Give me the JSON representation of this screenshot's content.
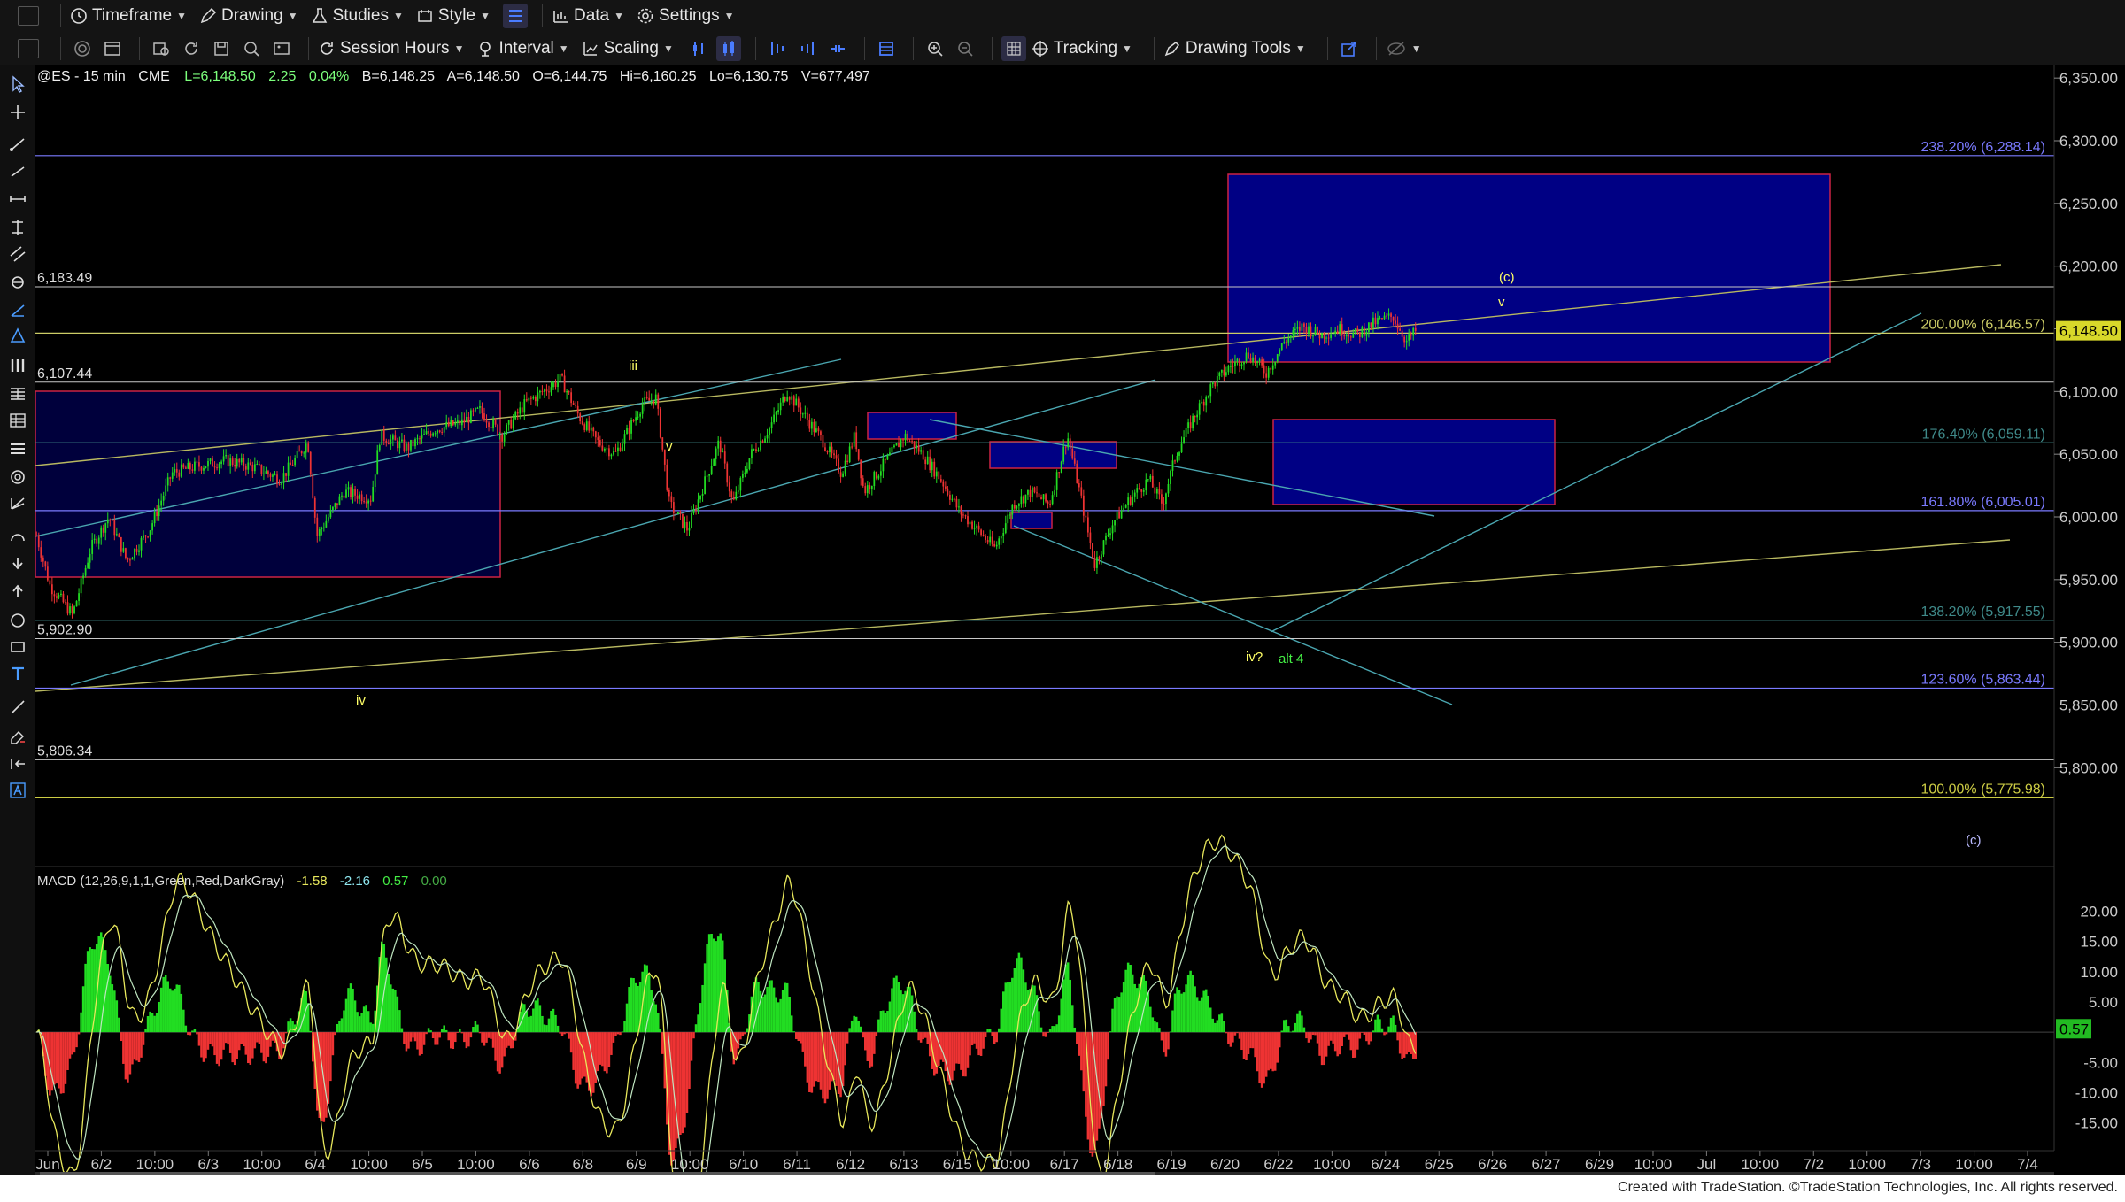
{
  "toolbar1": {
    "items": [
      "Timeframe",
      "Drawing",
      "Studies",
      "Style",
      "Data",
      "Settings"
    ]
  },
  "toolbar2": {
    "items": [
      "Session Hours",
      "Interval",
      "Scaling",
      "Tracking",
      "Drawing Tools"
    ]
  },
  "symbol_info": {
    "symbol": "@ES - 15 min",
    "exchange": "CME",
    "last": "L=6,148.50",
    "change": "2.25",
    "change_pct": "0.04%",
    "bid": "B=6,148.25",
    "ask": "A=6,148.50",
    "open": "O=6,144.75",
    "hi": "Hi=6,160.25",
    "lo": "Lo=6,130.75",
    "volume": "V=677,497"
  },
  "macd_label": {
    "name": "MACD (12,26,9,1,1,Green,Red,DarkGray)",
    "v1": "-1.58",
    "v2": "-2.16",
    "v3": "0.57",
    "v4": "0.00"
  },
  "colors": {
    "up": "#22dd22",
    "down": "#ee3333",
    "fib": "#7a7aff",
    "box": "#00008b",
    "trend_yellow": "#cccc66",
    "trend_cyan": "#5fb3b3",
    "label_yellow": "#ffff66",
    "label_green": "#44ee44",
    "price_tag": "#d8d82a"
  },
  "chart_data": {
    "type": "candlestick",
    "y_axis": {
      "min": 5760,
      "max": 6360,
      "ticks": [
        "6,350.00",
        "6,300.00",
        "6,250.00",
        "6,200.00",
        "6,150.00",
        "6,100.00",
        "6,050.00",
        "6,000.00",
        "5,950.00",
        "5,900.00",
        "5,850.00",
        "5,800.00"
      ],
      "current_price": "6,148.50"
    },
    "x_ticks": [
      "Jun",
      "6/2",
      "10:00",
      "6/3",
      "10:00",
      "6/4",
      "10:00",
      "6/5",
      "10:00",
      "6/6",
      "6/8",
      "6/9",
      "10:00",
      "6/10",
      "6/11",
      "6/12",
      "6/13",
      "6/15",
      "10:00",
      "6/17",
      "6/18",
      "6/19",
      "6/20",
      "6/22",
      "10:00",
      "6/24",
      "6/25",
      "6/26",
      "6/27",
      "6/29",
      "10:00",
      "Jul",
      "10:00",
      "7/2",
      "10:00",
      "7/3",
      "10:00",
      "7/4"
    ],
    "fib_levels": [
      {
        "label": "238.20% (6,288.14)",
        "value": 6288.14
      },
      {
        "label": "200.00% (6,146.57)",
        "value": 6146.57
      },
      {
        "label": "176.40% (6,059.11)",
        "value": 6059.11
      },
      {
        "label": "161.80% (6,005.01)",
        "value": 6005.01
      },
      {
        "label": "138.20% (5,917.55)",
        "value": 5917.55
      },
      {
        "label": "123.60% (5,863.44)",
        "value": 5863.44
      },
      {
        "label": "100.00% (5,775.98)",
        "value": 5775.98
      }
    ],
    "horizontal_levels": [
      {
        "label": "6,183.49",
        "value": 6183.49
      },
      {
        "label": "6,107.44",
        "value": 6107.44
      },
      {
        "label": "5,902.90",
        "value": 5902.9
      },
      {
        "label": "5,806.34",
        "value": 5806.34
      }
    ],
    "wave_labels": [
      "iii",
      "iv",
      "v",
      "(c)",
      "v",
      "iv?",
      "alt 4",
      "(c)"
    ],
    "price_path": [
      {
        "x": 0,
        "y": 5985
      },
      {
        "x": 0.3,
        "y": 5945
      },
      {
        "x": 0.8,
        "y": 5922
      },
      {
        "x": 1.2,
        "y": 5975
      },
      {
        "x": 1.6,
        "y": 6000
      },
      {
        "x": 2.0,
        "y": 5965
      },
      {
        "x": 2.5,
        "y": 5990
      },
      {
        "x": 3.0,
        "y": 6035
      },
      {
        "x": 3.5,
        "y": 6040
      },
      {
        "x": 4.2,
        "y": 6045
      },
      {
        "x": 4.8,
        "y": 6040
      },
      {
        "x": 5.4,
        "y": 6030
      },
      {
        "x": 6.0,
        "y": 6060
      },
      {
        "x": 6.2,
        "y": 5985
      },
      {
        "x": 6.8,
        "y": 6020
      },
      {
        "x": 7.4,
        "y": 6015
      },
      {
        "x": 7.6,
        "y": 6065
      },
      {
        "x": 8.2,
        "y": 6055
      },
      {
        "x": 8.8,
        "y": 6070
      },
      {
        "x": 9.4,
        "y": 6075
      },
      {
        "x": 9.8,
        "y": 6085
      },
      {
        "x": 10.3,
        "y": 6065
      },
      {
        "x": 10.8,
        "y": 6090
      },
      {
        "x": 11.6,
        "y": 6110
      },
      {
        "x": 12.0,
        "y": 6080
      },
      {
        "x": 12.4,
        "y": 6060
      },
      {
        "x": 12.8,
        "y": 6050
      },
      {
        "x": 13.4,
        "y": 6090
      },
      {
        "x": 13.7,
        "y": 6095
      },
      {
        "x": 14.0,
        "y": 6010
      },
      {
        "x": 14.4,
        "y": 5990
      },
      {
        "x": 14.8,
        "y": 6030
      },
      {
        "x": 15.1,
        "y": 6060
      },
      {
        "x": 15.4,
        "y": 6010
      },
      {
        "x": 15.8,
        "y": 6050
      },
      {
        "x": 16.2,
        "y": 6070
      },
      {
        "x": 16.6,
        "y": 6100
      },
      {
        "x": 17.0,
        "y": 6080
      },
      {
        "x": 17.4,
        "y": 6060
      },
      {
        "x": 17.8,
        "y": 6035
      },
      {
        "x": 18.1,
        "y": 6065
      },
      {
        "x": 18.3,
        "y": 6020
      },
      {
        "x": 18.7,
        "y": 6040
      },
      {
        "x": 19.2,
        "y": 6065
      },
      {
        "x": 19.6,
        "y": 6050
      },
      {
        "x": 20.0,
        "y": 6030
      },
      {
        "x": 20.4,
        "y": 6005
      },
      {
        "x": 20.8,
        "y": 5990
      },
      {
        "x": 21.2,
        "y": 5975
      },
      {
        "x": 21.6,
        "y": 6010
      },
      {
        "x": 22.0,
        "y": 6020
      },
      {
        "x": 22.4,
        "y": 6010
      },
      {
        "x": 22.8,
        "y": 6065
      },
      {
        "x": 23.1,
        "y": 6015
      },
      {
        "x": 23.4,
        "y": 5962
      },
      {
        "x": 23.8,
        "y": 5995
      },
      {
        "x": 24.2,
        "y": 6015
      },
      {
        "x": 24.6,
        "y": 6030
      },
      {
        "x": 24.9,
        "y": 6010
      },
      {
        "x": 25.2,
        "y": 6050
      },
      {
        "x": 25.6,
        "y": 6080
      },
      {
        "x": 26.0,
        "y": 6105
      },
      {
        "x": 26.4,
        "y": 6120
      },
      {
        "x": 26.8,
        "y": 6130
      },
      {
        "x": 27.2,
        "y": 6115
      },
      {
        "x": 27.6,
        "y": 6140
      },
      {
        "x": 28.0,
        "y": 6152
      },
      {
        "x": 28.4,
        "y": 6145
      },
      {
        "x": 28.8,
        "y": 6150
      },
      {
        "x": 29.2,
        "y": 6145
      },
      {
        "x": 29.6,
        "y": 6155
      },
      {
        "x": 30.0,
        "y": 6160
      },
      {
        "x": 30.3,
        "y": 6140
      },
      {
        "x": 30.5,
        "y": 6148
      }
    ],
    "macd_axis": {
      "ticks": [
        "20.00",
        "15.00",
        "10.00",
        "5.00",
        "0.57",
        "-5.00",
        "-10.00",
        "-15.00"
      ],
      "min": -19,
      "max": 23,
      "current": "0.57"
    }
  },
  "footer": {
    "credit": "Created with TradeStation. ©TradeStation Technologies, Inc. All rights reserved."
  }
}
